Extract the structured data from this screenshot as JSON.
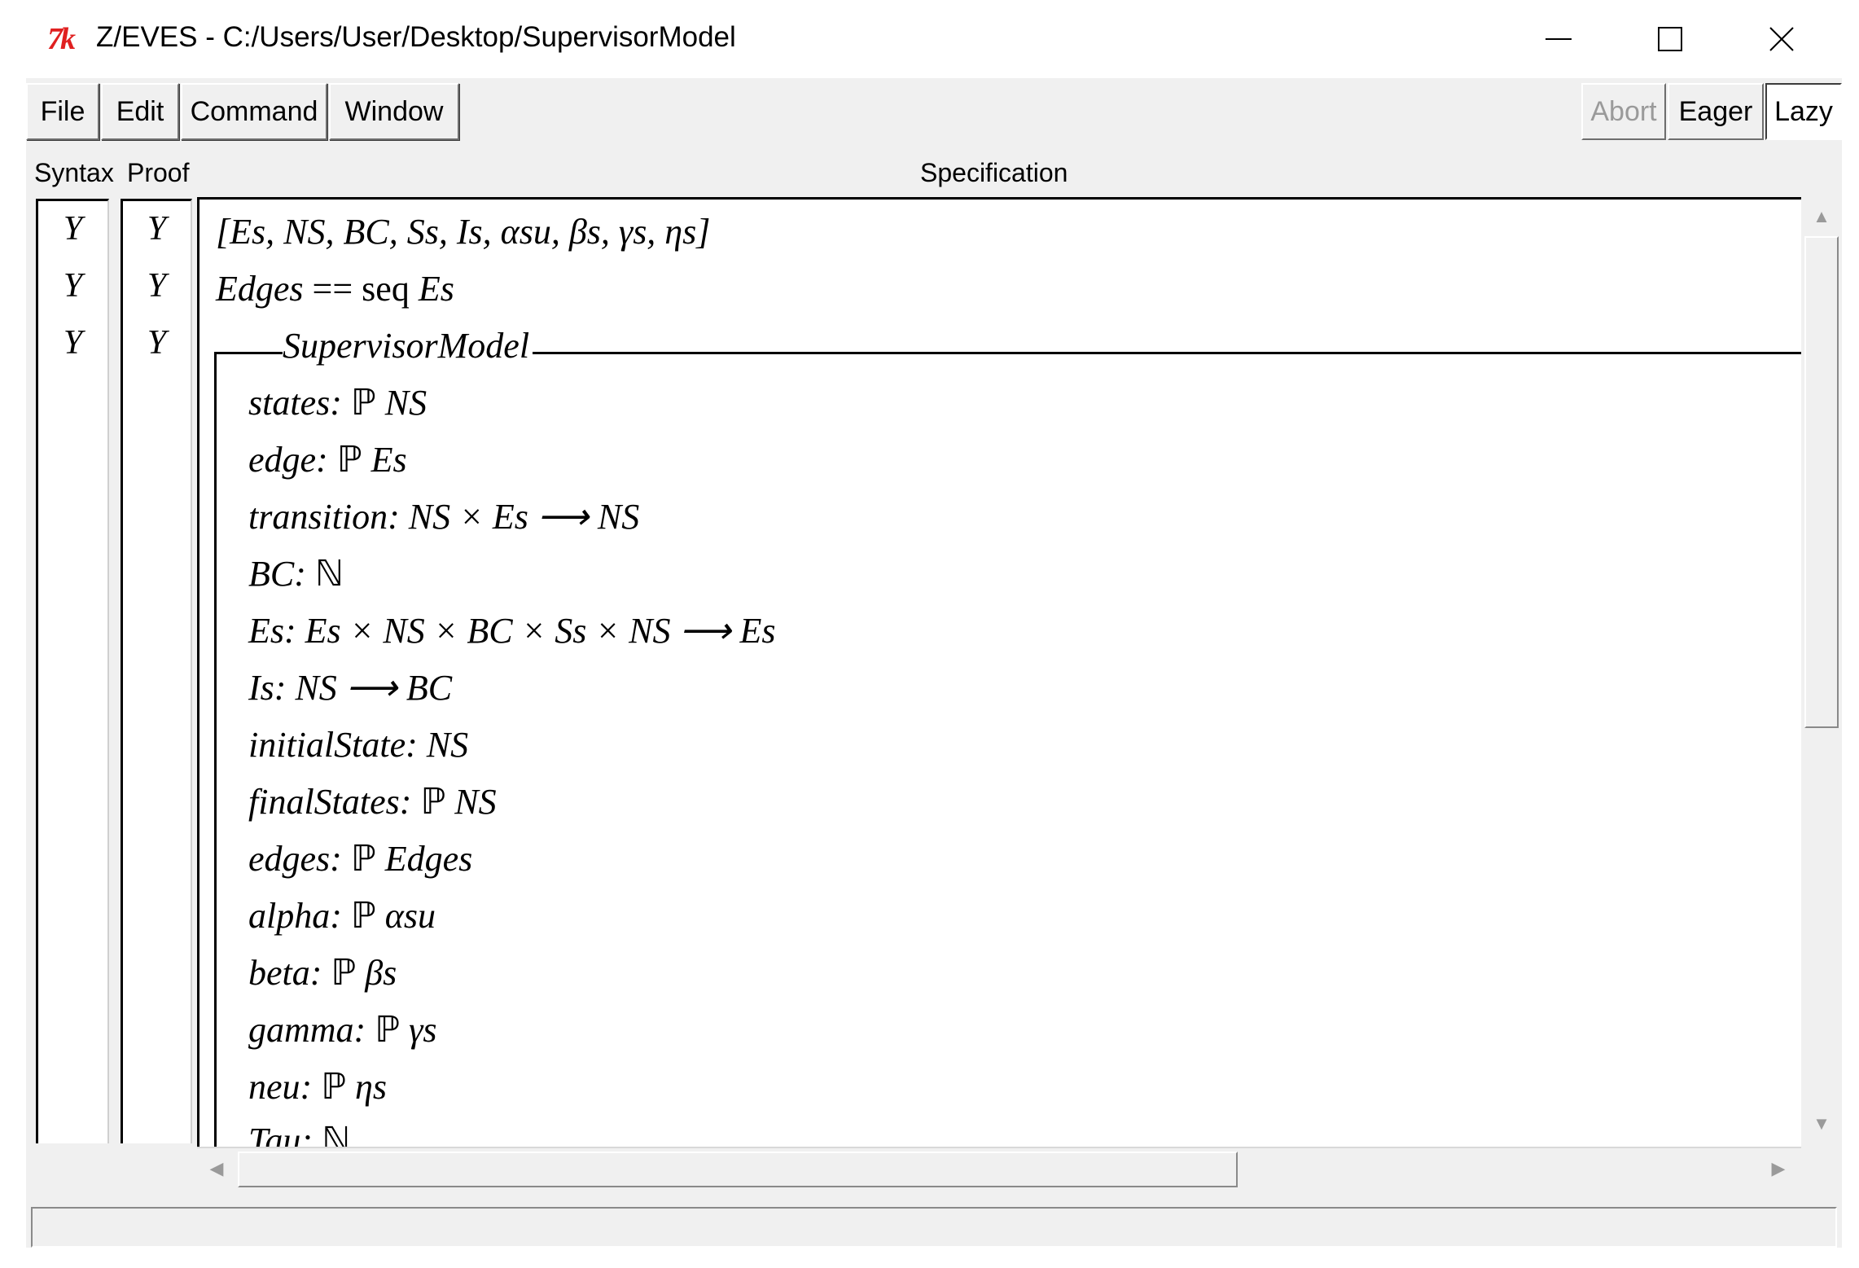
{
  "window": {
    "logo": "7k",
    "title": "Z/EVES - C:/Users/User/Desktop/SupervisorModel"
  },
  "menu": [
    "File",
    "Edit",
    "Command",
    "Window"
  ],
  "toolbar": {
    "abort": "Abort",
    "eager": "Eager",
    "lazy": "Lazy"
  },
  "columns": {
    "syntax": "Syntax",
    "proof": "Proof",
    "spec": "Specification"
  },
  "rows": [
    {
      "syntax": "Y",
      "proof": "Y"
    },
    {
      "syntax": "Y",
      "proof": "Y"
    },
    {
      "syntax": "Y",
      "proof": "Y"
    }
  ],
  "spec": {
    "given": "[Es, NS, BC, Ss, Is, αsu, βs, γs, ηs]",
    "edges_name": "Edges",
    "edges_def": " == seq ",
    "edges_type": "Es",
    "schema_name": "SupervisorModel",
    "decls": [
      {
        "name": "states:",
        "type": " ℙ ",
        "rest": "NS"
      },
      {
        "name": "edge:",
        "type": " ℙ ",
        "rest": "Es"
      },
      {
        "name": "transition:",
        "type": " ",
        "rest": "NS × Es ⟶ NS"
      },
      {
        "name": "BC:",
        "type": " ℕ",
        "rest": ""
      },
      {
        "name": "Es:",
        "type": " ",
        "rest": "Es × NS × BC × Ss × NS ⟶ Es"
      },
      {
        "name": "Is:",
        "type": " ",
        "rest": "NS ⟶ BC"
      },
      {
        "name": "initialState:",
        "type": " ",
        "rest": "NS"
      },
      {
        "name": "finalStates:",
        "type": " ℙ ",
        "rest": "NS"
      },
      {
        "name": "edges:",
        "type": " ℙ ",
        "rest": "Edges"
      },
      {
        "name": "alpha:",
        "type": " ℙ ",
        "rest": "αsu"
      },
      {
        "name": "beta:",
        "type": " ℙ ",
        "rest": "βs"
      },
      {
        "name": "gamma:",
        "type": " ℙ ",
        "rest": "γs"
      },
      {
        "name": "neu:",
        "type": " ℙ ",
        "rest": "ηs"
      },
      {
        "name": "Tau:",
        "type": " ℕ",
        "rest": ""
      }
    ]
  },
  "status": ""
}
